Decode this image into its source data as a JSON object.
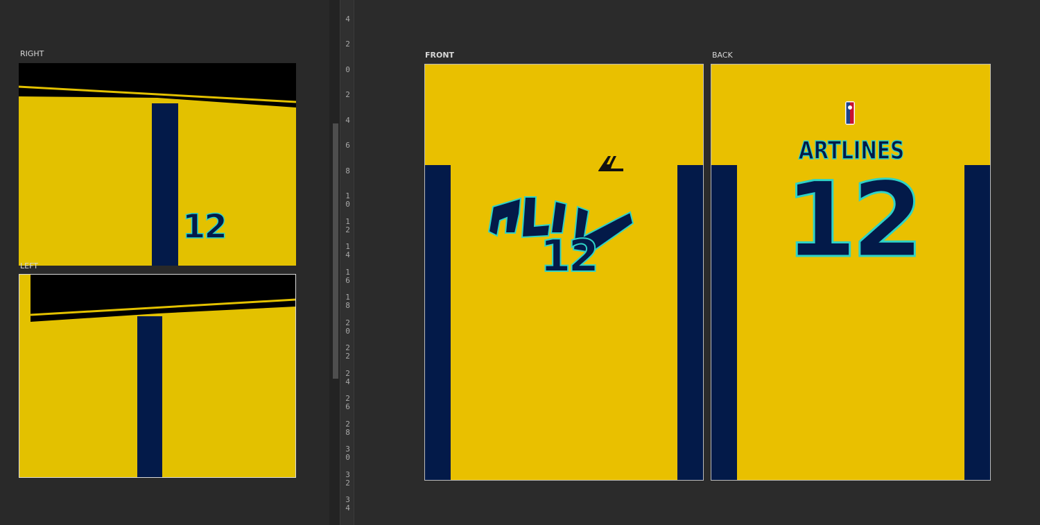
{
  "panels": {
    "right_label": "RIGHT",
    "left_label": "LEFT",
    "front_label": "FRONT",
    "back_label": "BACK"
  },
  "jersey": {
    "number": "12",
    "back_name": "ARTLINES",
    "front_wordmark": "ALIV",
    "brand_logo": "AL",
    "league_logo_icon": "nba-logo-icon"
  },
  "ruler": {
    "ticks": [
      "4",
      "2",
      "0",
      "2",
      "4",
      "6",
      "8",
      "1\n0",
      "1\n2",
      "1\n4",
      "1\n6",
      "1\n8",
      "2\n0",
      "2\n2",
      "2\n4",
      "2\n6",
      "2\n8",
      "3\n0",
      "3\n2",
      "3\n4"
    ]
  },
  "colors": {
    "body_yellow": "#e3c100",
    "front_yellow": "#e9c000",
    "navy": "#031a49",
    "teal_accent": "#2fd3c7",
    "collar_black": "#000000"
  }
}
